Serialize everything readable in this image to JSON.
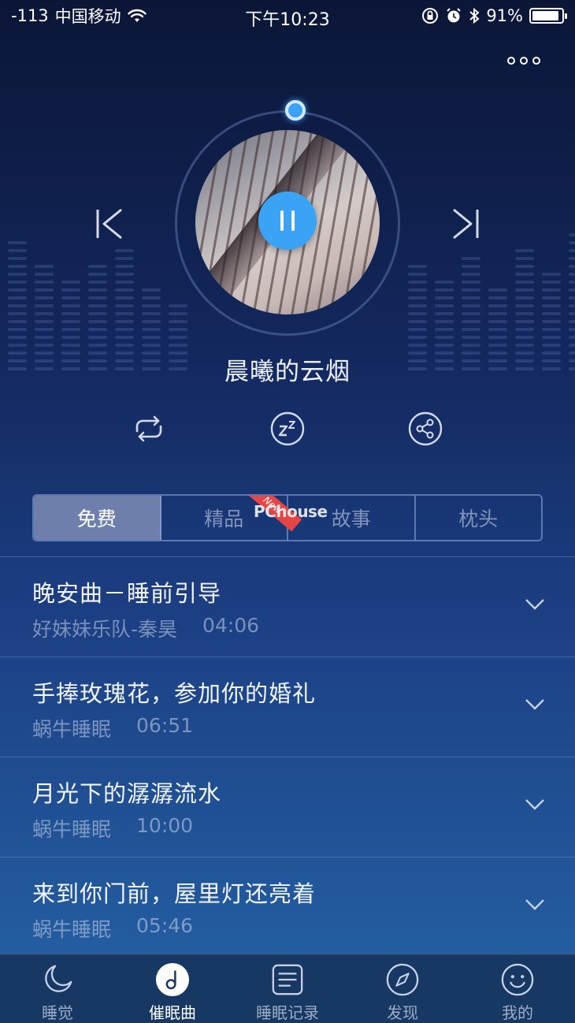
{
  "status_bar": {
    "signal": "-113",
    "carrier": "中国移动",
    "time": "下午10:23",
    "battery": "91%",
    "battery_level": 0.91
  },
  "player": {
    "song_title": "晨曦的云烟",
    "state": "playing"
  },
  "tabs": [
    {
      "label": "免费",
      "active": true
    },
    {
      "label": "精品",
      "active": false,
      "badge": "New"
    },
    {
      "label": "故事",
      "active": false
    },
    {
      "label": "枕头",
      "active": false
    }
  ],
  "watermark": "PChouse",
  "tracks": [
    {
      "title": "晚安曲－睡前引导",
      "artist": "好妹妹乐队-秦昊",
      "duration": "04:06"
    },
    {
      "title": "手捧玫瑰花，参加你的婚礼",
      "artist": "蜗牛睡眠",
      "duration": "06:51"
    },
    {
      "title": "月光下的潺潺流水",
      "artist": "蜗牛睡眠",
      "duration": "10:00"
    },
    {
      "title": "来到你门前，屋里灯还亮着",
      "artist": "蜗牛睡眠",
      "duration": "05:46"
    }
  ],
  "tabbar": [
    {
      "label": "睡觉",
      "icon": "moon-icon",
      "active": false
    },
    {
      "label": "催眠曲",
      "icon": "music-note-icon",
      "active": true
    },
    {
      "label": "睡眠记录",
      "icon": "document-icon",
      "active": false
    },
    {
      "label": "发现",
      "icon": "compass-icon",
      "active": false
    },
    {
      "label": "我的",
      "icon": "smiley-icon",
      "active": false
    }
  ],
  "colors": {
    "accent": "#3aa3f5",
    "tab_active": "#6f7fac",
    "badge": "#e64545"
  }
}
